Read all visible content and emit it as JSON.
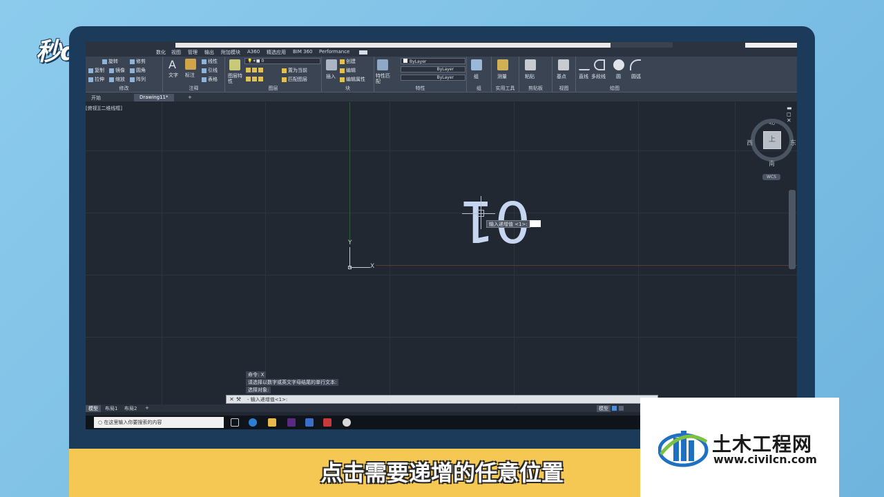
{
  "brand": {
    "logo_text": "秒dong视频"
  },
  "titlebar": {
    "search_placeholder": ""
  },
  "menu": {
    "items": [
      "数化",
      "视图",
      "管理",
      "输出",
      "附加模块",
      "A360",
      "精选应用",
      "BIM 360",
      "Performance"
    ]
  },
  "ribbon": {
    "modify": {
      "label": "修改",
      "items": [
        "旋转",
        "修剪",
        "复制",
        "镜像",
        "圆角",
        "拉伸",
        "缩放",
        "阵列"
      ]
    },
    "annotation": {
      "label": "注释",
      "items": [
        "文字",
        "标注",
        "线性",
        "引线",
        "表格"
      ]
    },
    "layers": {
      "label": "图层",
      "items": [
        "图层特性",
        "置为当前",
        "匹配图层"
      ],
      "current_layer": "0"
    },
    "block": {
      "label": "块",
      "items": [
        "插入",
        "创建",
        "编辑",
        "编辑属性"
      ]
    },
    "properties": {
      "label": "特性",
      "items": [
        "特性匹配"
      ],
      "bylayer1": "ByLayer",
      "bylayer2": "ByLayer",
      "bylayer3": "ByLayer"
    },
    "groups": {
      "label": "组",
      "items": [
        "组"
      ]
    },
    "utilities": {
      "label": "实用工具",
      "items": [
        "测量"
      ]
    },
    "clipboard": {
      "label": "剪贴板",
      "items": [
        "粘贴"
      ]
    },
    "view": {
      "label": "视图",
      "items": [
        "基点"
      ]
    },
    "draw": {
      "label": "绘图",
      "items": [
        "直线",
        "多段线",
        "圆",
        "圆弧"
      ]
    }
  },
  "tabs": [
    {
      "label": "开始"
    },
    {
      "label": "Drawing11*"
    },
    {
      "label": "+"
    }
  ],
  "viewport": {
    "view_label": "[俯视][二维线框]",
    "big_text": "01",
    "tooltip": "输入递增值 <1>:",
    "ucs_x": "X",
    "ucs_y": "Y"
  },
  "viewcube": {
    "north": "北",
    "south": "南",
    "east": "东",
    "west": "西",
    "top": "上",
    "wcs": "WCS"
  },
  "command": {
    "history": [
      "命令: X",
      "请选择以数字或英文字母结尾的单行文本:",
      "选择对象:"
    ],
    "prompt": "- 输入递增值<1>:"
  },
  "layout_tabs": [
    "模型",
    "布局1",
    "布局2",
    "+"
  ],
  "status": {
    "model_label": "模型"
  },
  "taskbar": {
    "search_placeholder": "在这里输入你要搜索的内容"
  },
  "subtitle": "点击需要递增的任意位置",
  "watermark": {
    "title": "土木工程网",
    "url": "www.civilcn.com"
  },
  "colors": {
    "accent": "#f5c753",
    "canvas": "#212832",
    "text_obj": "#c6d6f0"
  }
}
